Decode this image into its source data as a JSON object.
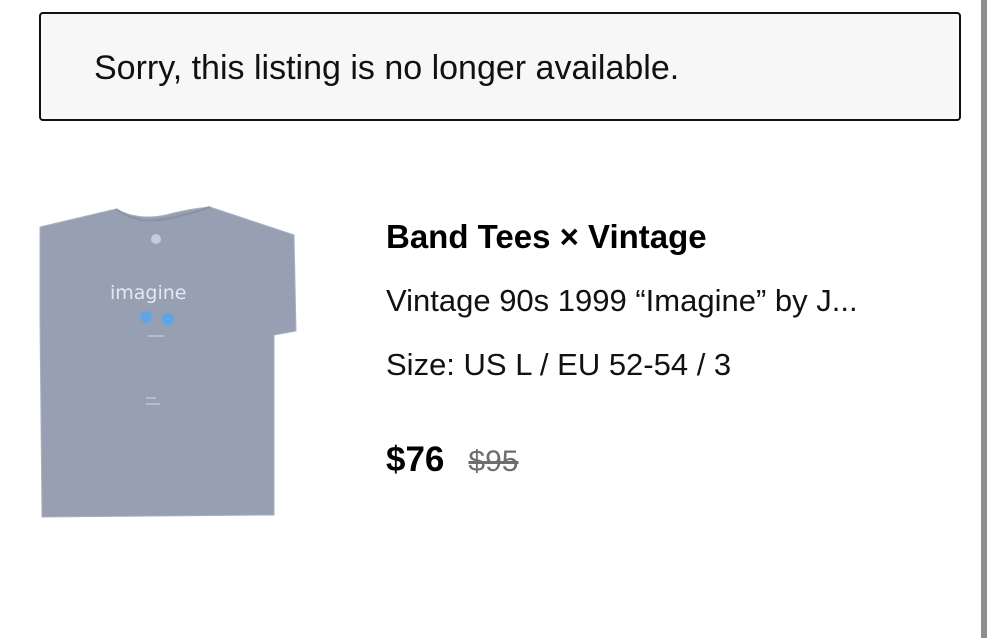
{
  "notice": {
    "text": "Sorry, this listing is no longer available."
  },
  "listing": {
    "image_icon": "tshirt-photo",
    "shirt_print": "imagine",
    "brand": "Band Tees × Vintage",
    "title": "Vintage 90s 1999 “Imagine” by J...",
    "size": "Size: US L / EU 52-54 / 3",
    "price_current": "$76",
    "price_original": "$95"
  },
  "colors": {
    "shirt": "#97a0b2",
    "banner_border": "#111111",
    "banner_bg": "#f7f7f7",
    "strikethrough_price": "#6e6e6e"
  }
}
